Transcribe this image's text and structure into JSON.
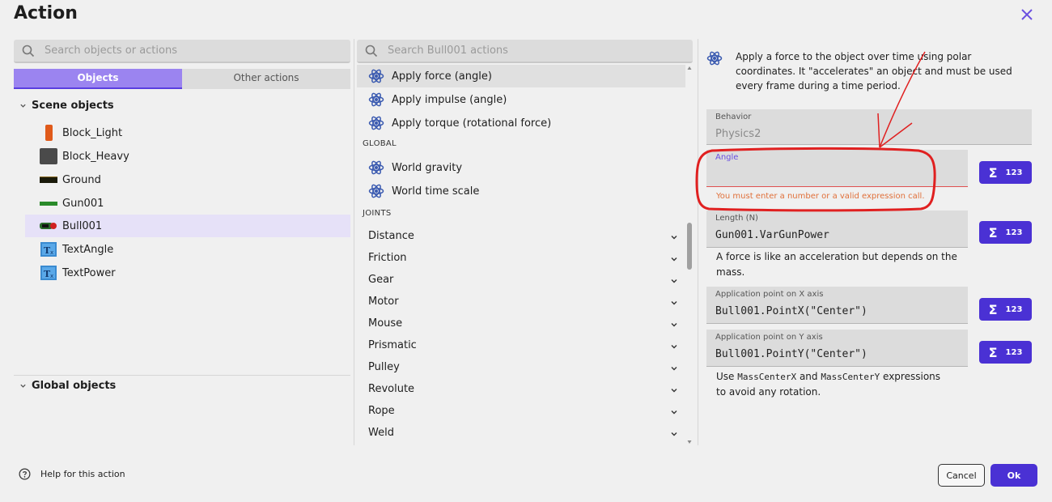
{
  "dialog": {
    "title": "Action"
  },
  "objects_panel": {
    "search_placeholder": "Search objects or actions",
    "tabs": [
      {
        "label": "Objects"
      },
      {
        "label": "Other actions"
      }
    ],
    "scene_header": "Scene objects",
    "scene_objects": [
      {
        "name": "Block_Light",
        "thumb_color": "#e05a1a"
      },
      {
        "name": "Block_Heavy",
        "thumb_color": "#4a4a4a"
      },
      {
        "name": "Ground",
        "thumb_color": "#1a1a0a"
      },
      {
        "name": "Gun001",
        "thumb_color": "#2a8a2a"
      },
      {
        "name": "Bull001",
        "thumb_color": "#2a6a2a"
      },
      {
        "name": "TextAngle",
        "thumb_color": "#3a8ad0"
      },
      {
        "name": "TextPower",
        "thumb_color": "#3a8ad0"
      }
    ],
    "global_header": "Global objects"
  },
  "actions_panel": {
    "search_placeholder": "Search Bull001 actions",
    "top_actions": [
      {
        "label": "Apply force (angle)"
      },
      {
        "label": "Apply impulse (angle)"
      },
      {
        "label": "Apply torque (rotational force)"
      }
    ],
    "global_header": "GLOBAL",
    "global_actions": [
      {
        "label": "World gravity"
      },
      {
        "label": "World time scale"
      }
    ],
    "joints_header": "JOINTS",
    "joints": [
      {
        "label": "Distance"
      },
      {
        "label": "Friction"
      },
      {
        "label": "Gear"
      },
      {
        "label": "Motor"
      },
      {
        "label": "Mouse"
      },
      {
        "label": "Prismatic"
      },
      {
        "label": "Pulley"
      },
      {
        "label": "Revolute"
      },
      {
        "label": "Rope"
      },
      {
        "label": "Weld"
      }
    ]
  },
  "details_panel": {
    "description": "Apply a force to the object over time using polar coordinates. It \"accelerates\" an object and must be used every frame during a time period.",
    "behavior": {
      "label": "Behavior",
      "value": "Physics2"
    },
    "angle": {
      "label": "Angle",
      "value": "",
      "error": "You must enter a number or a valid expression call."
    },
    "length": {
      "label": "Length (N)",
      "value": "Gun001.VarGunPower",
      "help": "A force is like an acceleration but depends on the mass."
    },
    "point_x": {
      "label": "Application point on X axis",
      "value": "Bull001.PointX(\"Center\")"
    },
    "point_y": {
      "label": "Application point on Y axis",
      "value": "Bull001.PointY(\"Center\")"
    },
    "footer_help": {
      "use": "Use",
      "x_expr": "MassCenterX",
      "and": "and",
      "y_expr": "MassCenterY",
      "rest": "expressions",
      "line2": "to avoid any rotation."
    },
    "expr_button": {
      "sigma": "Σ",
      "num": "123"
    }
  },
  "footer": {
    "help": "Help for this action",
    "cancel": "Cancel",
    "ok": "Ok"
  },
  "colors": {
    "accent": "#4a31d4",
    "tab_active": "#9b84f0",
    "error": "#e0703a",
    "annotation": "#e02020"
  }
}
